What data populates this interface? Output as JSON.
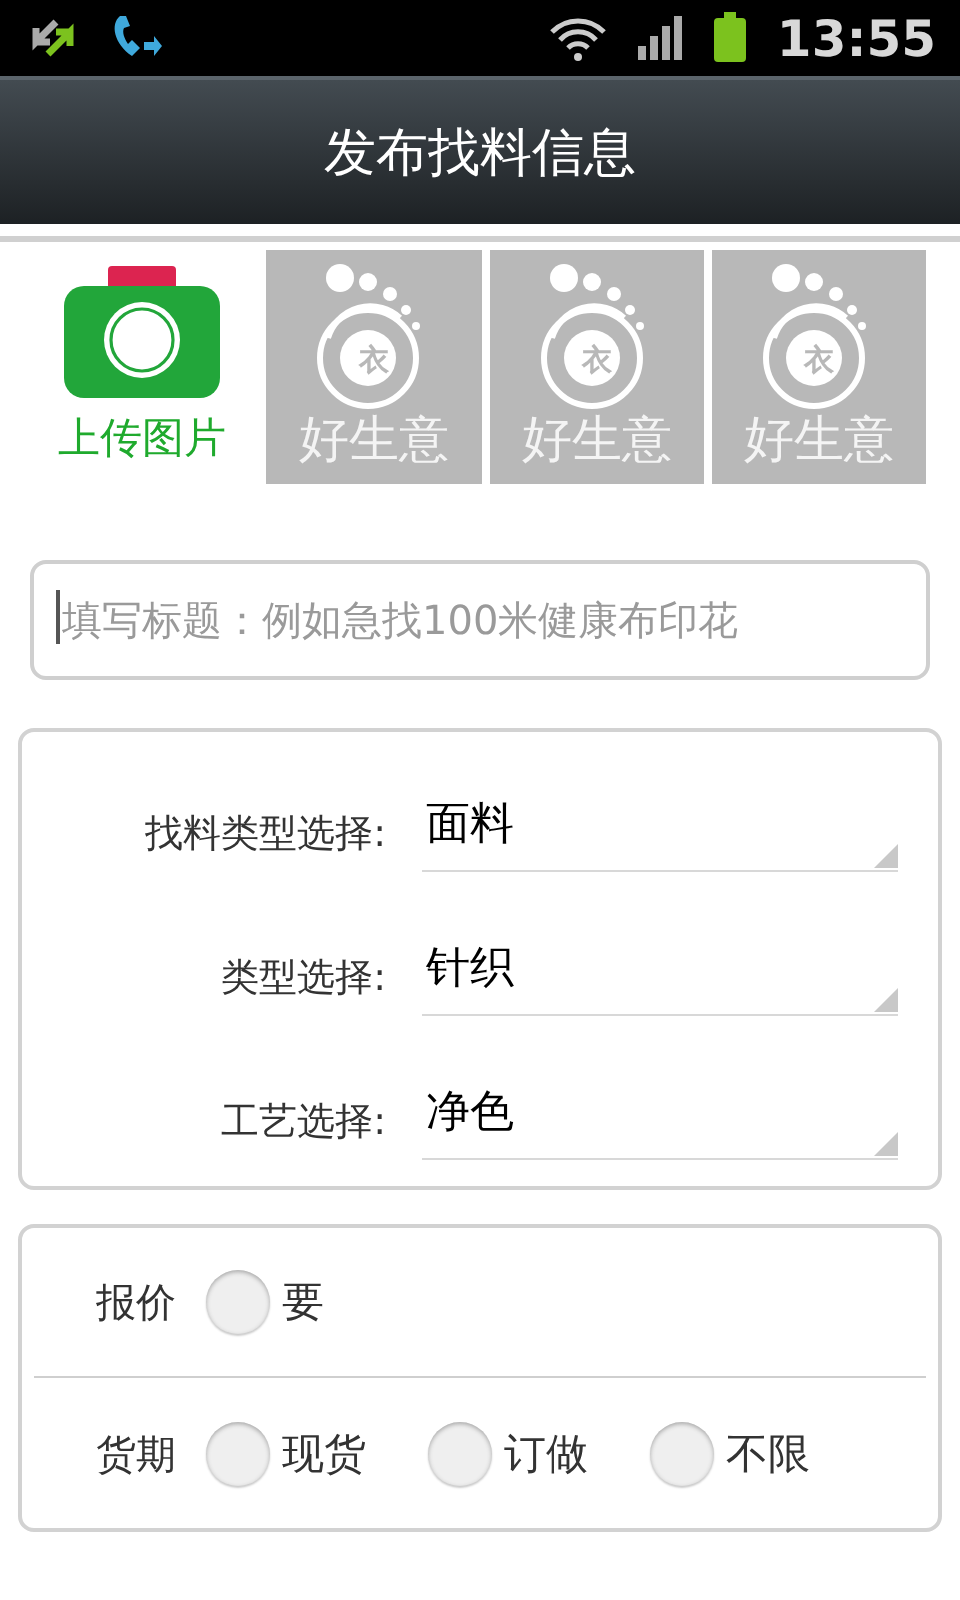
{
  "status_bar": {
    "time": "13:55"
  },
  "header": {
    "title": "发布找料信息"
  },
  "photos": {
    "upload_label": "上传图片",
    "thumbnails": [
      {
        "mark": "衣",
        "caption": "好生意"
      },
      {
        "mark": "衣",
        "caption": "好生意"
      },
      {
        "mark": "衣",
        "caption": "好生意"
      }
    ]
  },
  "title_field": {
    "placeholder": "填写标题：例如急找100米健康布印花",
    "focused": true
  },
  "selects": [
    {
      "label": "找料类型选择:",
      "value": "面料"
    },
    {
      "label": "类型选择:",
      "value": "针织"
    },
    {
      "label": "工艺选择:",
      "value": "净色"
    }
  ],
  "options": [
    {
      "label": "报价",
      "choices": [
        {
          "label": "要",
          "selected": false
        }
      ]
    },
    {
      "label": "货期",
      "choices": [
        {
          "label": "现货",
          "selected": false
        },
        {
          "label": "订做",
          "selected": false
        },
        {
          "label": "不限",
          "selected": false
        }
      ]
    }
  ]
}
